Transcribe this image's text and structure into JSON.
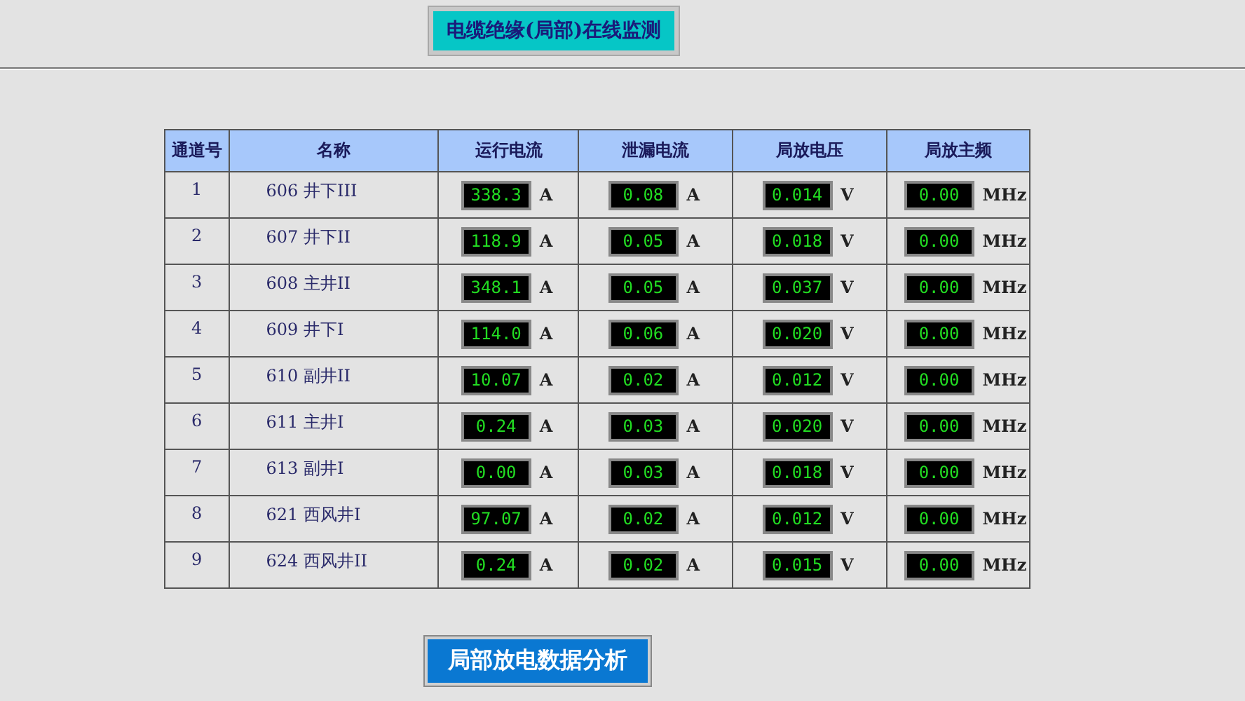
{
  "title": "电缆绝缘(局部)在线监测",
  "table": {
    "columns": [
      "通道号",
      "名称",
      "运行电流",
      "泄漏电流",
      "局放电压",
      "局放主频"
    ],
    "rows": [
      {
        "channel": "1",
        "name": "606 井下III",
        "readings": [
          {
            "value": "338.3",
            "unit": "A"
          },
          {
            "value": "0.08",
            "unit": "A"
          },
          {
            "value": "0.014",
            "unit": "V"
          },
          {
            "value": "0.00",
            "unit": "MHz"
          }
        ]
      },
      {
        "channel": "2",
        "name": "607 井下II",
        "readings": [
          {
            "value": "118.9",
            "unit": "A"
          },
          {
            "value": "0.05",
            "unit": "A"
          },
          {
            "value": "0.018",
            "unit": "V"
          },
          {
            "value": "0.00",
            "unit": "MHz"
          }
        ]
      },
      {
        "channel": "3",
        "name": "608 主井II",
        "readings": [
          {
            "value": "348.1",
            "unit": "A"
          },
          {
            "value": "0.05",
            "unit": "A"
          },
          {
            "value": "0.037",
            "unit": "V"
          },
          {
            "value": "0.00",
            "unit": "MHz"
          }
        ]
      },
      {
        "channel": "4",
        "name": "609 井下I",
        "readings": [
          {
            "value": "114.0",
            "unit": "A"
          },
          {
            "value": "0.06",
            "unit": "A"
          },
          {
            "value": "0.020",
            "unit": "V"
          },
          {
            "value": "0.00",
            "unit": "MHz"
          }
        ]
      },
      {
        "channel": "5",
        "name": "610 副井II",
        "readings": [
          {
            "value": "10.07",
            "unit": "A"
          },
          {
            "value": "0.02",
            "unit": "A"
          },
          {
            "value": "0.012",
            "unit": "V"
          },
          {
            "value": "0.00",
            "unit": "MHz"
          }
        ]
      },
      {
        "channel": "6",
        "name": "611 主井I",
        "readings": [
          {
            "value": "0.24",
            "unit": "A"
          },
          {
            "value": "0.03",
            "unit": "A"
          },
          {
            "value": "0.020",
            "unit": "V"
          },
          {
            "value": "0.00",
            "unit": "MHz"
          }
        ]
      },
      {
        "channel": "7",
        "name": "613 副井I",
        "readings": [
          {
            "value": "0.00",
            "unit": "A"
          },
          {
            "value": "0.03",
            "unit": "A"
          },
          {
            "value": "0.018",
            "unit": "V"
          },
          {
            "value": "0.00",
            "unit": "MHz"
          }
        ]
      },
      {
        "channel": "8",
        "name": "621 西风井I",
        "readings": [
          {
            "value": "97.07",
            "unit": "A"
          },
          {
            "value": "0.02",
            "unit": "A"
          },
          {
            "value": "0.012",
            "unit": "V"
          },
          {
            "value": "0.00",
            "unit": "MHz"
          }
        ]
      },
      {
        "channel": "9",
        "name": "624 西风井II",
        "readings": [
          {
            "value": "0.24",
            "unit": "A"
          },
          {
            "value": "0.02",
            "unit": "A"
          },
          {
            "value": "0.015",
            "unit": "V"
          },
          {
            "value": "0.00",
            "unit": "MHz"
          }
        ]
      }
    ]
  },
  "analysis_button": "局部放电数据分析"
}
